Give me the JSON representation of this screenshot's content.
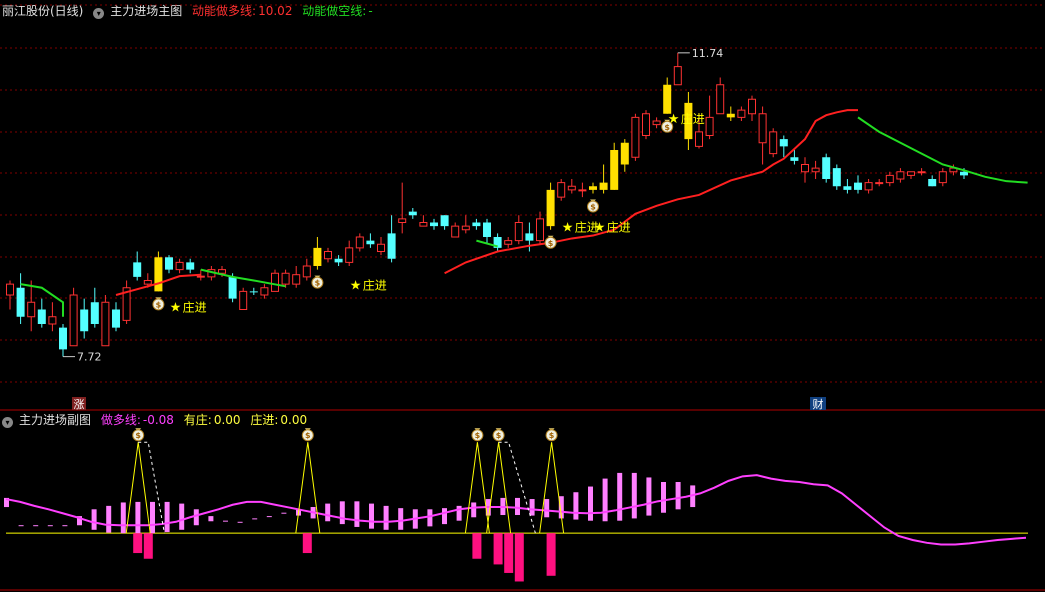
{
  "main_header": {
    "stock_title": "丽江股份(日线)",
    "indicator_name": "主力进场主图",
    "bull_line_label": "动能做多线:",
    "bull_line_value": "10.02",
    "bear_line_label": "动能做空线:",
    "bear_line_value": "-"
  },
  "sub_header": {
    "indicator_name": "主力进场副图",
    "bull_label": "做多线:",
    "bull_value": "-0.08",
    "has_zhuang_label": "有庄:",
    "has_zhuang_value": "0.00",
    "zhuang_jin_label": "庄进:",
    "zhuang_jin_value": "0.00"
  },
  "badges": {
    "zhang": "涨",
    "cai": "财"
  },
  "colors": {
    "up": "#ff3232",
    "down": "#54ffff",
    "signal_candle": "#ffe000",
    "bull_line": "#ff2020",
    "bear_line": "#22dd22",
    "osc_line": "#ff40ff",
    "osc_bar": "#ff80ff",
    "neg_bar": "#ff1080",
    "signal_line": "#ffff00",
    "grid": "#800000",
    "text_yellow": "#ffff00"
  },
  "icons": {
    "money_bag": "money-bag-icon",
    "star": "star-icon",
    "dropdown": "chevron-down-icon"
  },
  "chart_data": [
    {
      "type": "candlestick",
      "title": "丽江股份(日线)",
      "price_high_label": "11.74",
      "price_low_label": "7.72",
      "ylim": [
        7.2,
        12.4
      ],
      "candles": [
        [
          8.4,
          8.55,
          8.2,
          8.6
        ],
        [
          8.5,
          8.1,
          8.0,
          8.7
        ],
        [
          8.1,
          8.3,
          7.9,
          8.6
        ],
        [
          8.2,
          8.0,
          7.95,
          8.35
        ],
        [
          8.0,
          8.1,
          7.9,
          8.3
        ],
        [
          7.95,
          7.65,
          7.55,
          8.0
        ],
        [
          7.7,
          8.4,
          7.7,
          8.5
        ],
        [
          8.2,
          7.9,
          7.8,
          8.35
        ],
        [
          8.3,
          8.0,
          7.95,
          8.5
        ],
        [
          7.7,
          8.3,
          7.72,
          8.4
        ],
        [
          8.2,
          7.95,
          7.9,
          8.3
        ],
        [
          8.05,
          8.5,
          8.0,
          8.6
        ],
        [
          8.85,
          8.65,
          8.6,
          9.0
        ],
        [
          8.55,
          8.6,
          8.5,
          8.7
        ],
        [
          8.45,
          8.92,
          8.45,
          9.0
        ],
        [
          8.92,
          8.75,
          8.7,
          8.95
        ],
        [
          8.75,
          8.85,
          8.7,
          8.9
        ],
        [
          8.85,
          8.75,
          8.7,
          8.9
        ],
        [
          8.65,
          8.66,
          8.6,
          8.75
        ],
        [
          8.65,
          8.75,
          8.6,
          8.8
        ],
        [
          8.7,
          8.75,
          8.65,
          8.8
        ],
        [
          8.65,
          8.35,
          8.3,
          8.7
        ],
        [
          8.2,
          8.45,
          8.2,
          8.5
        ],
        [
          8.45,
          8.44,
          8.4,
          8.5
        ],
        [
          8.4,
          8.5,
          8.35,
          8.55
        ],
        [
          8.45,
          8.7,
          8.45,
          8.75
        ],
        [
          8.55,
          8.7,
          8.5,
          8.75
        ],
        [
          8.55,
          8.68,
          8.5,
          8.8
        ],
        [
          8.65,
          8.8,
          8.6,
          8.9
        ],
        [
          8.8,
          9.05,
          8.75,
          9.2
        ],
        [
          8.9,
          9.0,
          8.85,
          9.05
        ],
        [
          8.9,
          8.85,
          8.8,
          8.95
        ],
        [
          8.85,
          9.05,
          8.8,
          9.15
        ],
        [
          9.05,
          9.2,
          9.0,
          9.25
        ],
        [
          9.15,
          9.1,
          9.05,
          9.25
        ],
        [
          9.0,
          9.1,
          8.95,
          9.2
        ],
        [
          9.25,
          8.9,
          8.85,
          9.5
        ],
        [
          9.4,
          9.45,
          9.25,
          9.95
        ],
        [
          9.55,
          9.5,
          9.45,
          9.6
        ],
        [
          9.35,
          9.4,
          9.35,
          9.5
        ],
        [
          9.4,
          9.35,
          9.3,
          9.45
        ],
        [
          9.5,
          9.35,
          9.3,
          9.5
        ],
        [
          9.2,
          9.35,
          9.2,
          9.4
        ],
        [
          9.3,
          9.35,
          9.25,
          9.5
        ],
        [
          9.4,
          9.35,
          9.3,
          9.45
        ],
        [
          9.4,
          9.2,
          9.1,
          9.45
        ],
        [
          9.2,
          9.05,
          9.0,
          9.25
        ],
        [
          9.1,
          9.15,
          9.05,
          9.2
        ],
        [
          9.15,
          9.4,
          9.1,
          9.5
        ],
        [
          9.25,
          9.15,
          9.0,
          9.4
        ],
        [
          9.15,
          9.45,
          9.1,
          9.55
        ],
        [
          9.35,
          9.85,
          9.3,
          9.95
        ],
        [
          9.75,
          9.95,
          9.7,
          10.0
        ],
        [
          9.85,
          9.9,
          9.8,
          10.0
        ],
        [
          9.85,
          9.85,
          9.75,
          9.95
        ],
        [
          9.9,
          9.85,
          9.8,
          9.95
        ],
        [
          9.85,
          9.95,
          9.8,
          10.2
        ],
        [
          9.85,
          10.4,
          9.85,
          10.5
        ],
        [
          10.2,
          10.5,
          10.1,
          10.55
        ],
        [
          10.3,
          10.85,
          10.25,
          10.9
        ],
        [
          10.6,
          10.9,
          10.55,
          10.95
        ],
        [
          10.75,
          10.8,
          10.7,
          10.85
        ],
        [
          10.9,
          11.3,
          10.9,
          11.4
        ],
        [
          11.3,
          11.55,
          11.3,
          11.74
        ],
        [
          11.05,
          10.55,
          10.4,
          11.2
        ],
        [
          10.45,
          10.65,
          10.42,
          10.9
        ],
        [
          10.6,
          10.85,
          10.55,
          11.15
        ],
        [
          10.9,
          11.3,
          10.9,
          11.4
        ],
        [
          10.85,
          10.9,
          10.8,
          11.0
        ],
        [
          10.85,
          10.95,
          10.8,
          11.0
        ],
        [
          10.9,
          11.1,
          10.8,
          11.15
        ],
        [
          10.5,
          10.9,
          10.2,
          11.0
        ],
        [
          10.35,
          10.65,
          10.3,
          10.7
        ],
        [
          10.55,
          10.45,
          10.3,
          10.6
        ],
        [
          10.3,
          10.25,
          10.2,
          10.4
        ],
        [
          10.1,
          10.2,
          9.95,
          10.3
        ],
        [
          10.1,
          10.15,
          10.0,
          10.25
        ],
        [
          10.3,
          10.0,
          9.95,
          10.35
        ],
        [
          10.15,
          9.9,
          9.85,
          10.2
        ],
        [
          9.9,
          9.85,
          9.8,
          10.0
        ],
        [
          9.95,
          9.85,
          9.8,
          10.05
        ],
        [
          9.85,
          9.95,
          9.8,
          10.0
        ],
        [
          9.95,
          9.95,
          9.9,
          10.0
        ],
        [
          9.95,
          10.05,
          9.9,
          10.1
        ],
        [
          10.0,
          10.1,
          9.95,
          10.15
        ],
        [
          10.05,
          10.1,
          10.0,
          10.1
        ],
        [
          10.1,
          10.1,
          10.05,
          10.15
        ],
        [
          10.0,
          9.9,
          9.9,
          10.05
        ],
        [
          9.95,
          10.1,
          9.9,
          10.15
        ],
        [
          10.1,
          10.15,
          10.05,
          10.2
        ],
        [
          10.1,
          10.05,
          10.0,
          10.15
        ]
      ],
      "signal_candles": [
        14,
        29,
        51,
        55,
        56,
        57,
        58,
        62,
        64,
        68
      ],
      "bull_line": [
        [
          10,
          8.4
        ],
        [
          14,
          8.56
        ],
        [
          16,
          8.66
        ],
        [
          18,
          8.68
        ]
      ],
      "bull_line_2": [
        [
          41,
          8.7
        ],
        [
          43,
          8.85
        ],
        [
          46,
          9.0
        ],
        [
          49,
          9.08
        ],
        [
          51,
          9.12
        ],
        [
          53,
          9.18
        ],
        [
          55,
          9.22
        ],
        [
          57,
          9.3
        ],
        [
          59,
          9.52
        ],
        [
          61,
          9.63
        ],
        [
          63,
          9.72
        ],
        [
          65,
          9.78
        ],
        [
          68,
          9.98
        ],
        [
          71,
          10.1
        ],
        [
          72,
          10.2
        ],
        [
          73,
          10.28
        ],
        [
          75,
          10.55
        ],
        [
          76,
          10.8
        ],
        [
          77,
          10.88
        ],
        [
          78,
          10.92
        ],
        [
          79,
          10.95
        ],
        [
          80,
          10.95
        ]
      ],
      "bear_line": [
        [
          1,
          8.55
        ],
        [
          3,
          8.5
        ],
        [
          5,
          8.3
        ],
        [
          5,
          8.1
        ]
      ],
      "bear_line_2": [
        [
          18,
          8.75
        ],
        [
          21,
          8.65
        ],
        [
          23,
          8.6
        ],
        [
          26,
          8.52
        ]
      ],
      "bear_line_3": [
        [
          44,
          9.15
        ],
        [
          46,
          9.07
        ]
      ],
      "bear_line_4": [
        [
          80,
          10.85
        ],
        [
          82,
          10.65
        ],
        [
          84,
          10.5
        ],
        [
          86,
          10.35
        ],
        [
          88,
          10.2
        ],
        [
          90,
          10.12
        ],
        [
          92,
          10.03
        ],
        [
          94,
          9.97
        ],
        [
          96,
          9.95
        ]
      ],
      "annotations": [
        {
          "kind": "money-bag",
          "index": 14
        },
        {
          "kind": "money-bag",
          "index": 29
        },
        {
          "kind": "money-bag",
          "index": 51
        },
        {
          "kind": "money-bag",
          "index": 55
        },
        {
          "kind": "money-bag",
          "index": 62
        },
        {
          "kind": "zhuang-jin",
          "text": "庄进",
          "index": 16
        },
        {
          "kind": "zhuang-jin",
          "text": "庄进",
          "index": 33
        },
        {
          "kind": "zhuang-jin",
          "text": "庄进",
          "index": 53
        },
        {
          "kind": "zhuang-jin",
          "text": "庄进",
          "index": 56
        },
        {
          "kind": "zhuang-jin",
          "text": "庄进",
          "index": 63
        }
      ]
    },
    {
      "type": "oscillator",
      "title": "主力进场副图",
      "ylim": [
        -1.0,
        1.85
      ],
      "osc_line": [
        0.6,
        0.55,
        0.48,
        0.42,
        0.35,
        0.28,
        0.2,
        0.15,
        0.14,
        0.14,
        0.14,
        0.16,
        0.2,
        0.28,
        0.35,
        0.42,
        0.5,
        0.55,
        0.55,
        0.5,
        0.45,
        0.4,
        0.35,
        0.3,
        0.25,
        0.22,
        0.2,
        0.2,
        0.22,
        0.26,
        0.3,
        0.36,
        0.42,
        0.45,
        0.46,
        0.46,
        0.45,
        0.42,
        0.4,
        0.38,
        0.36,
        0.35,
        0.36,
        0.4,
        0.45,
        0.5,
        0.56,
        0.6,
        0.64,
        0.7,
        0.8,
        0.92,
        1.0,
        1.02,
        0.96,
        0.92,
        0.9,
        0.86,
        0.84,
        0.7,
        0.5,
        0.3,
        0.1,
        -0.05,
        -0.12,
        -0.17,
        -0.2,
        -0.2,
        -0.18,
        -0.15,
        -0.12,
        -0.1,
        -0.08
      ],
      "osc_bars": [
        0.62,
        0.14,
        0.14,
        0.14,
        0.14,
        0.3,
        0.42,
        0.48,
        0.54,
        0.55,
        0.55,
        0.55,
        0.52,
        0.42,
        0.3,
        0.22,
        0.2,
        0.26,
        0.3,
        0.36,
        0.42,
        0.46,
        0.52,
        0.56,
        0.56,
        0.52,
        0.48,
        0.44,
        0.42,
        0.42,
        0.44,
        0.48,
        0.54,
        0.6,
        0.62,
        0.62,
        0.6,
        0.6,
        0.65,
        0.72,
        0.82,
        0.96,
        1.06,
        1.06,
        0.98,
        0.9,
        0.9,
        0.84
      ],
      "neg_bars": [
        [
          12,
          -0.35
        ],
        [
          13,
          -0.45
        ],
        [
          28,
          -0.35
        ],
        [
          44,
          -0.45
        ],
        [
          46,
          -0.55
        ],
        [
          47,
          -0.7
        ],
        [
          48,
          -0.85
        ],
        [
          51,
          -0.75
        ]
      ],
      "signal_peaks": [
        12,
        28,
        44,
        46,
        51
      ],
      "signal_baseline": 0.0,
      "signal_peak_value": 1.6
    }
  ]
}
